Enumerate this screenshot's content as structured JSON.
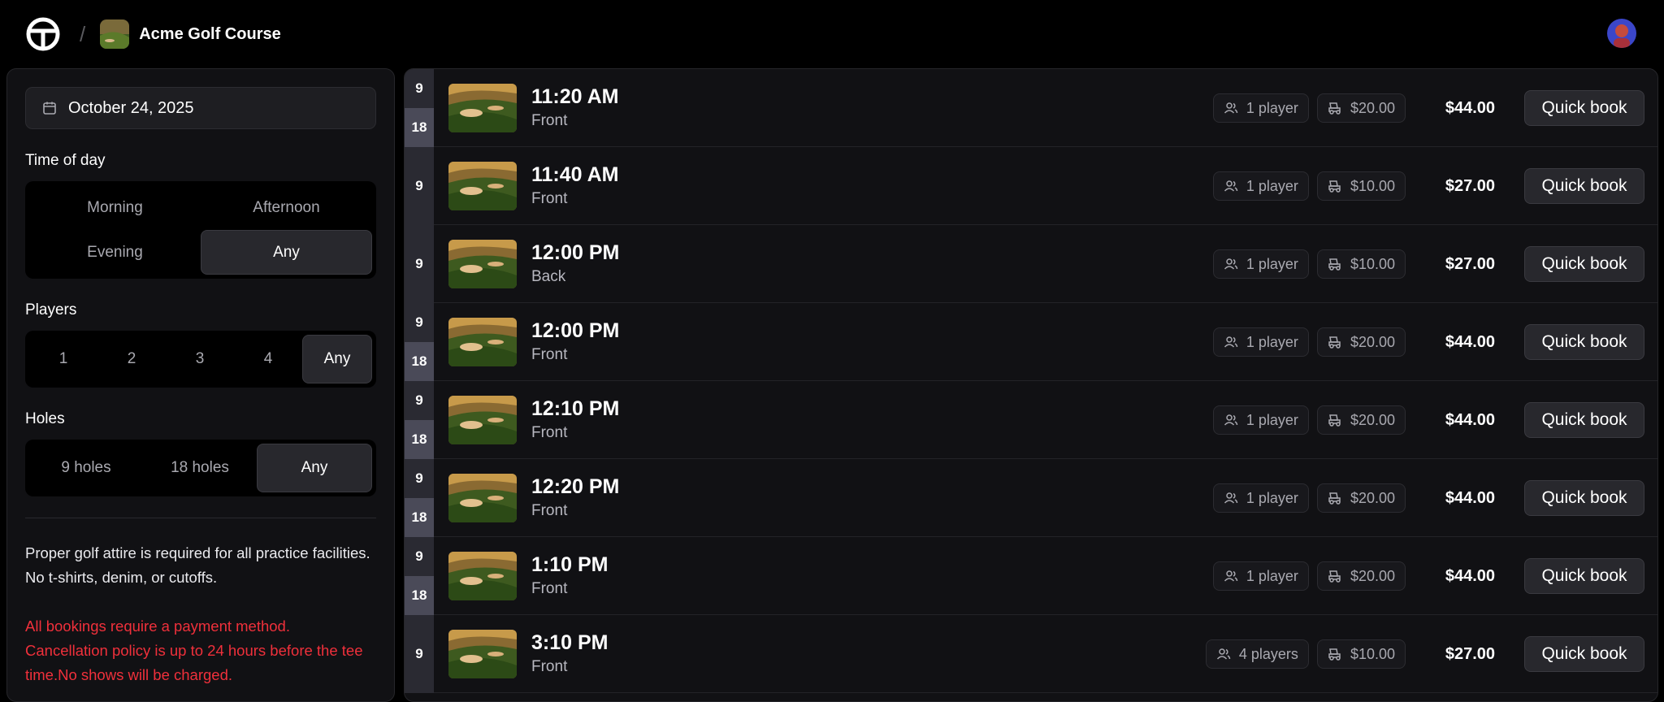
{
  "header": {
    "course_name": "Acme Golf Course",
    "separator": "/"
  },
  "sidebar": {
    "date": "October 24, 2025",
    "time_of_day": {
      "label": "Time of day",
      "options": [
        "Morning",
        "Afternoon",
        "Evening",
        "Any"
      ],
      "selected": "Any"
    },
    "players": {
      "label": "Players",
      "options": [
        "1",
        "2",
        "3",
        "4",
        "Any"
      ],
      "selected": "Any"
    },
    "holes": {
      "label": "Holes",
      "options": [
        "9 holes",
        "18 holes",
        "Any"
      ],
      "selected": "Any"
    },
    "note": "Proper golf attire is required for all practice facilities. No t-shirts, denim, or cutoffs.",
    "warning": "All bookings require a payment method. Cancellation policy is up to 24 hours before the tee time.No shows will be charged."
  },
  "tee_times": [
    {
      "holes": [
        "9",
        "18"
      ],
      "time": "11:20 AM",
      "course": "Front",
      "players": "1 player",
      "cart": "$20.00",
      "price": "$44.00",
      "action": "Quick book"
    },
    {
      "holes": [
        "9"
      ],
      "time": "11:40 AM",
      "course": "Front",
      "players": "1 player",
      "cart": "$10.00",
      "price": "$27.00",
      "action": "Quick book"
    },
    {
      "holes": [
        "9"
      ],
      "time": "12:00 PM",
      "course": "Back",
      "players": "1 player",
      "cart": "$10.00",
      "price": "$27.00",
      "action": "Quick book"
    },
    {
      "holes": [
        "9",
        "18"
      ],
      "time": "12:00 PM",
      "course": "Front",
      "players": "1 player",
      "cart": "$20.00",
      "price": "$44.00",
      "action": "Quick book"
    },
    {
      "holes": [
        "9",
        "18"
      ],
      "time": "12:10 PM",
      "course": "Front",
      "players": "1 player",
      "cart": "$20.00",
      "price": "$44.00",
      "action": "Quick book"
    },
    {
      "holes": [
        "9",
        "18"
      ],
      "time": "12:20 PM",
      "course": "Front",
      "players": "1 player",
      "cart": "$20.00",
      "price": "$44.00",
      "action": "Quick book"
    },
    {
      "holes": [
        "9",
        "18"
      ],
      "time": "1:10 PM",
      "course": "Front",
      "players": "1 player",
      "cart": "$20.00",
      "price": "$44.00",
      "action": "Quick book"
    },
    {
      "holes": [
        "9"
      ],
      "time": "3:10 PM",
      "course": "Front",
      "players": "4 players",
      "cart": "$10.00",
      "price": "$27.00",
      "action": "Quick book"
    }
  ],
  "colors": {
    "background": "#000000",
    "panel": "#111114",
    "accent_warning": "#f0303b"
  }
}
